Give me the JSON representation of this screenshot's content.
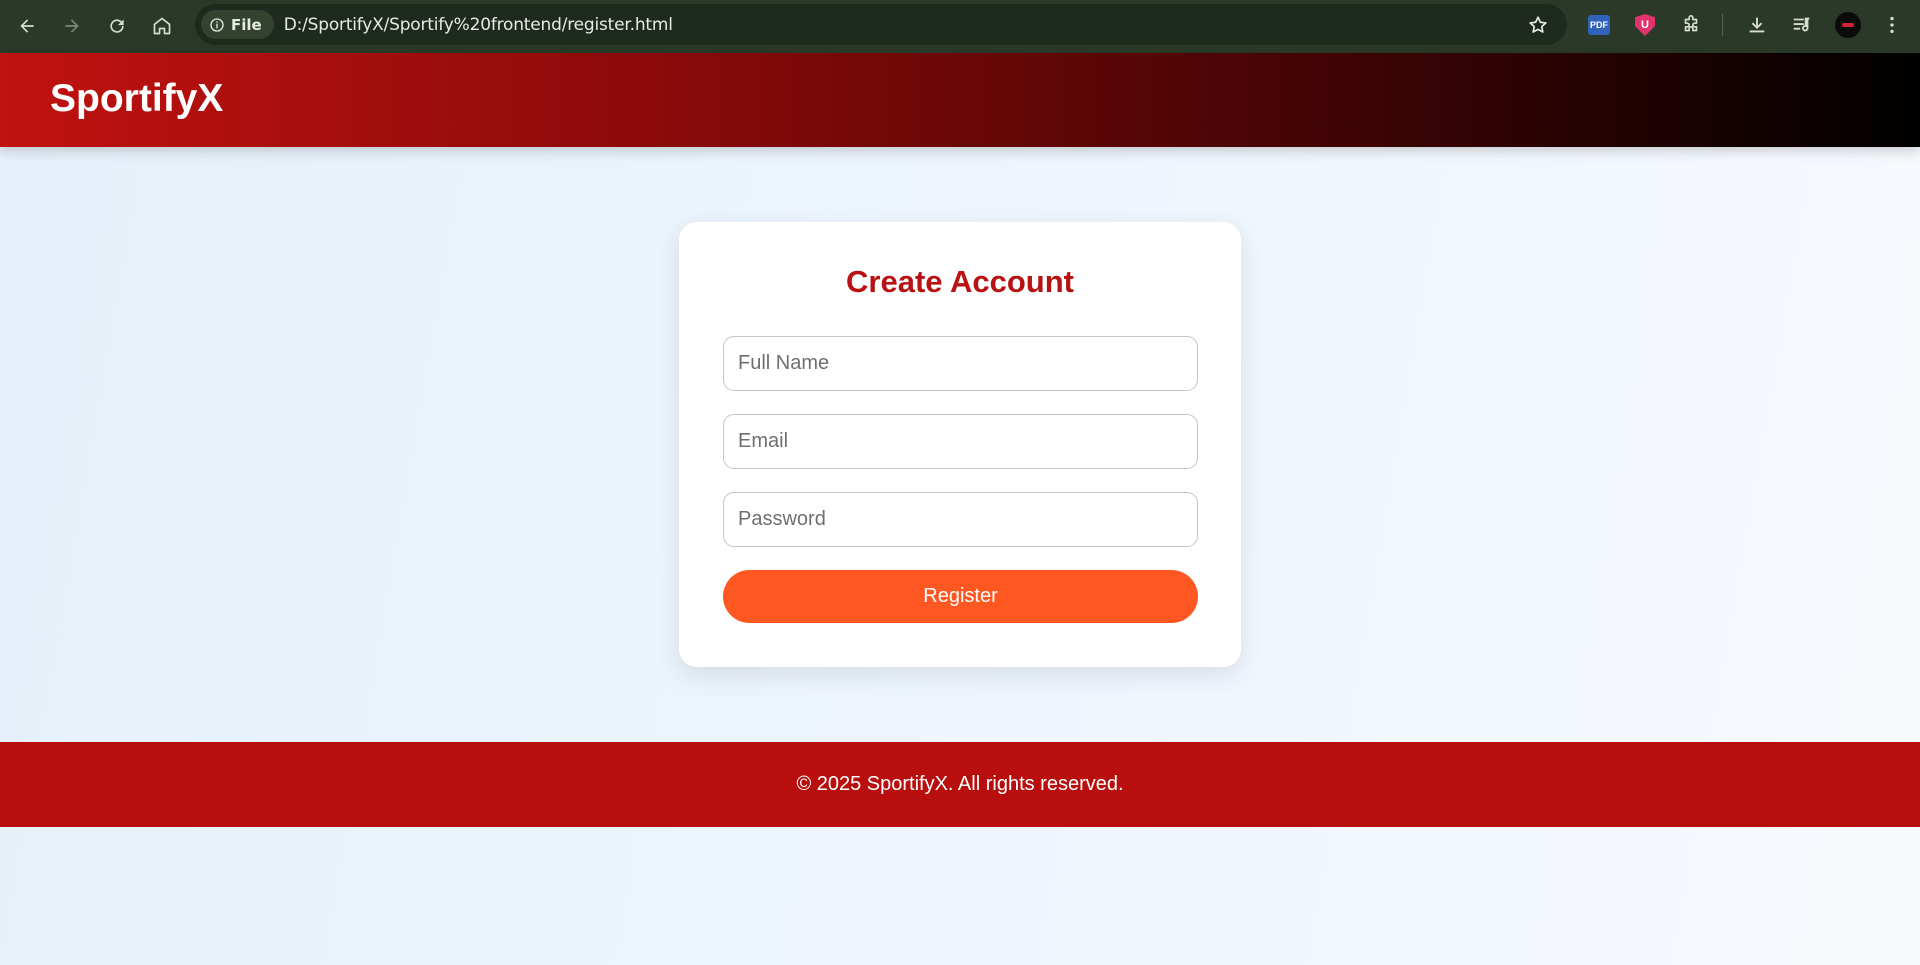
{
  "browser": {
    "site_chip_label": "File",
    "url": "D:/SportifyX/Sportify%20frontend/register.html",
    "extensions": [
      {
        "name": "pdf-extension",
        "label": "PDF"
      },
      {
        "name": "ublock-extension",
        "label": "U"
      }
    ]
  },
  "header": {
    "logo": "SportifyX"
  },
  "register_form": {
    "title": "Create Account",
    "fields": [
      {
        "name": "full-name",
        "placeholder": "Full Name",
        "value": ""
      },
      {
        "name": "email",
        "placeholder": "Email",
        "value": ""
      },
      {
        "name": "password",
        "placeholder": "Password",
        "value": ""
      }
    ],
    "submit_label": "Register"
  },
  "footer": {
    "text": "© 2025 SportifyX. All rights reserved."
  },
  "colors": {
    "brand_red": "#b81212",
    "button_orange": "#ff5722",
    "footer_red": "#b80e0e"
  }
}
